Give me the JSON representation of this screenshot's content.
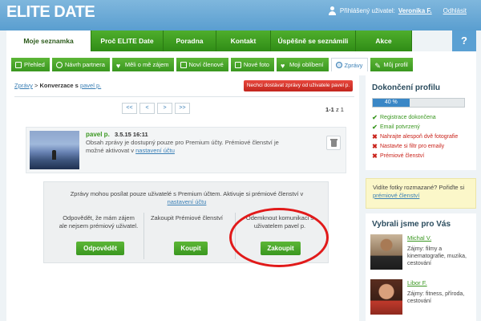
{
  "header": {
    "logo": "ELITE DATE",
    "user_label": "Přihlášený uživatel:",
    "user_name": "Veronika F.",
    "logout": "Odhlásit"
  },
  "main_nav": [
    {
      "label": "Moje seznamka",
      "active": true
    },
    {
      "label": "Proč ELITE Date"
    },
    {
      "label": "Poradna"
    },
    {
      "label": "Kontakt"
    },
    {
      "label": "Úspěšně se seznámili"
    },
    {
      "label": "Akce"
    }
  ],
  "help_button": "?",
  "sub_nav": [
    {
      "label": "Přehled",
      "icon": "overview-icon"
    },
    {
      "label": "Návrh partnera",
      "icon": "partner-icon"
    },
    {
      "label": "Měli o mě zájem",
      "icon": "heart-icon"
    },
    {
      "label": "Noví členové",
      "icon": "members-icon"
    },
    {
      "label": "Nové foto",
      "icon": "photo-icon"
    },
    {
      "label": "Moji oblíbení",
      "icon": "heart-icon"
    },
    {
      "label": "Zprávy",
      "icon": "speech-bubble-icon",
      "active": true
    },
    {
      "label": "Můj profil",
      "icon": "pencil-icon"
    }
  ],
  "breadcrumb": {
    "root": "Zprávy",
    "separator": ">",
    "current": "Konverzace s",
    "user": "pavel p."
  },
  "stop_button": "Nechci dostávat zprávy od uživatele pavel p.",
  "pager": {
    "buttons": [
      "<<",
      "<",
      ">",
      ">>"
    ],
    "current": "1-1",
    "total_text": "z 1"
  },
  "message": {
    "sender": "pavel p.",
    "date": "3.5.15 16:11",
    "text": "Obsah zprávy je dostupný pouze pro Premium účty. Prémiové členství je možné aktivovat v",
    "link": "nastavení účtu"
  },
  "premium": {
    "info": "Zprávy mohou posílat pouze uživatelé s Premium účtem. Aktivuje si prémiové členství v",
    "info_link": "nastavení účtu",
    "col1_text": "Odpovědět, že mám zájem ale nejsem prémiový uživatel.",
    "col1_btn": "Odpovědět",
    "col2_text": "Zakoupit Prémiové členství",
    "col2_btn": "Koupit",
    "col3_text": "Odemknout komunikaci s uživatelem pavel p.",
    "col3_btn": "Zakoupit"
  },
  "profile": {
    "title": "Dokončení profilu",
    "progress_label": "40 %",
    "progress": 0.4,
    "items": [
      {
        "label": "Registrace dokončena",
        "done": true
      },
      {
        "label": "Email potvrzený",
        "done": true
      },
      {
        "label": "Nahrajte alespoň dvě fotografie",
        "done": false
      },
      {
        "label": "Nastavte si filtr pro emaily",
        "done": false
      },
      {
        "label": "Prémiové členství",
        "done": false
      }
    ]
  },
  "photo_notice": {
    "text": "Vidíte fotky rozmazané? Pořiďte si",
    "link": "prémiové členství"
  },
  "picks": {
    "title": "Vybrali jsme pro Vás",
    "people": [
      {
        "name": "Michal V.",
        "interests": "Zájmy: filmy a kinematografie, muzika, cestování"
      },
      {
        "name": "Libor F.",
        "interests": "Zájmy: fitness, příroda, cestování"
      }
    ]
  },
  "colors": {
    "header_blue": "#5a9ed0",
    "nav_green": "#3a9720",
    "link_blue": "#3a7fb5",
    "alert_red": "#c2261e",
    "annotation_red": "#e11a1a"
  }
}
